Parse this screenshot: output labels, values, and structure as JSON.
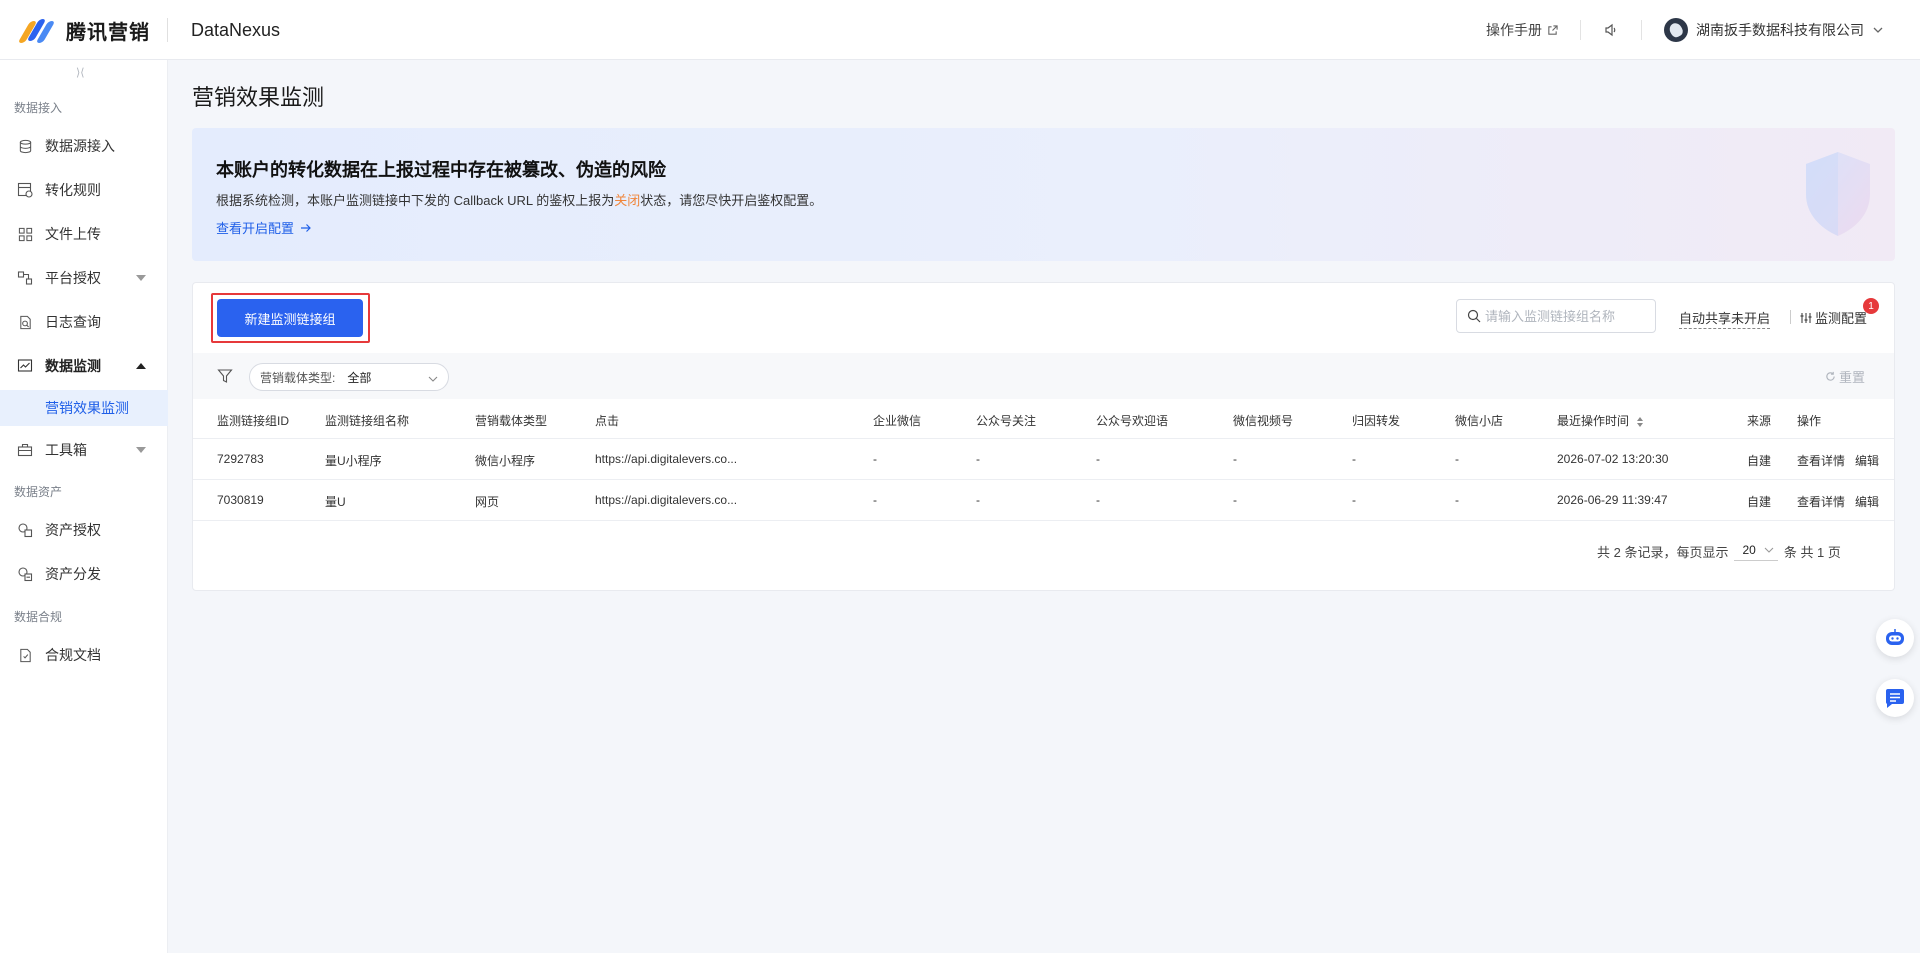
{
  "brand": {
    "name": "腾讯营销",
    "product": "DataNexus"
  },
  "header": {
    "manual": "操作手册",
    "account": "湖南扳手数据科技有限公司"
  },
  "sidebar": {
    "collapse_glyph": "⟩⟨",
    "groups": {
      "access": "数据接入",
      "assets": "数据资产",
      "compliance": "数据合规"
    },
    "items": {
      "datasource": "数据源接入",
      "rules": "转化规则",
      "upload": "文件上传",
      "platform": "平台授权",
      "logs": "日志查询",
      "monitor": "数据监测",
      "monitor_sub": "营销效果监测",
      "tools": "工具箱",
      "asset_auth": "资产授权",
      "asset_dist": "资产分发",
      "compliance_docs": "合规文档"
    }
  },
  "page": {
    "title": "营销效果监测"
  },
  "banner": {
    "title": "本账户的转化数据在上报过程中存在被篡改、伪造的风险",
    "desc_prefix": "根据系统检测，本账户监测链接中下发的 Callback URL 的鉴权上报为",
    "desc_warn": "关闭",
    "desc_suffix": "状态，请您尽快开启鉴权配置。",
    "link": "查看开启配置"
  },
  "toolbar": {
    "new_button": "新建监测链接组",
    "search_placeholder": "请输入监测链接组名称",
    "auto_share": "自动共享未开启",
    "monitor_config": "监测配置",
    "badge_count": "1"
  },
  "filter": {
    "label": "营销载体类型:",
    "value": "全部",
    "reset": "重置"
  },
  "table": {
    "headers": {
      "id": "监测链接组ID",
      "name": "监测链接组名称",
      "carrier": "营销载体类型",
      "click": "点击",
      "wecom": "企业微信",
      "follow": "公众号关注",
      "welcome": "公众号欢迎语",
      "channels": "微信视频号",
      "attribution": "归因转发",
      "shop": "微信小店",
      "time": "最近操作时间",
      "source": "来源",
      "ops": "操作"
    },
    "rows": [
      {
        "id": "7292783",
        "name": "量U小程序",
        "carrier": "微信小程序",
        "click": "https://api.digitalevers.co...",
        "wecom": "-",
        "follow": "-",
        "welcome": "-",
        "channels": "-",
        "attribution": "-",
        "shop": "-",
        "time": "2026-07-02 13:20:30",
        "source": "自建",
        "detail": "查看详情",
        "edit": "编辑"
      },
      {
        "id": "7030819",
        "name": "量U",
        "carrier": "网页",
        "click": "https://api.digitalevers.co...",
        "wecom": "-",
        "follow": "-",
        "welcome": "-",
        "channels": "-",
        "attribution": "-",
        "shop": "-",
        "time": "2026-06-29 11:39:47",
        "source": "自建",
        "detail": "查看详情",
        "edit": "编辑"
      }
    ]
  },
  "pagination": {
    "total": "共 2 条记录，每页显示",
    "page_size": "20",
    "unit": "条 共 1 页"
  },
  "colors": {
    "accent": "#2a62ef",
    "warning": "#f0853a",
    "highlight_border": "#e6393b"
  }
}
